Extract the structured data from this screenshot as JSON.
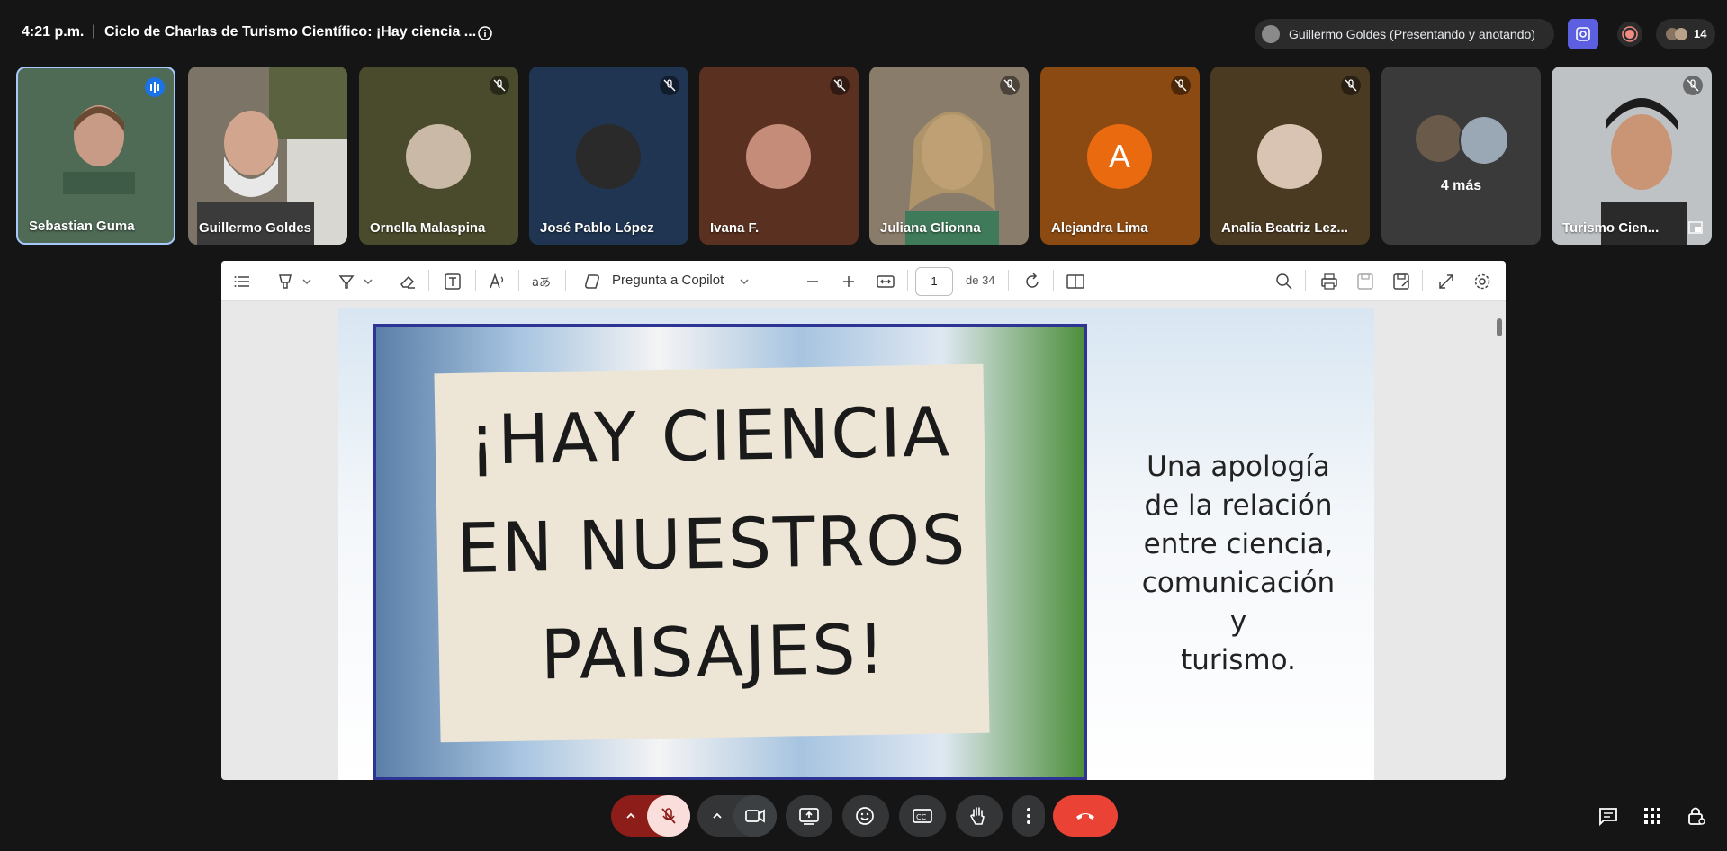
{
  "meeting": {
    "time": "4:21 p.m.",
    "separator": "|",
    "title": "Ciclo de Charlas de Turismo Científico: ¡Hay ciencia ...",
    "presenter_label": "Guillermo Goldes (Presentando y anotando)",
    "participant_count": "14"
  },
  "tiles": [
    {
      "name": "Sebastian Guma",
      "bg": "#4f6a55",
      "speaking": true
    },
    {
      "name": "Guillermo Goldes",
      "bg": "#7c7466"
    },
    {
      "name": "Ornella Malaspina",
      "bg": "#4a4a2c",
      "avatar": "#c9b9a6",
      "muted": true
    },
    {
      "name": "José Pablo López",
      "bg": "#1f3552",
      "avatar": "#2a2a2a",
      "muted": true
    },
    {
      "name": "Ivana F.",
      "bg": "#5a3020",
      "avatar": "#c58c7a",
      "muted": true
    },
    {
      "name": "Juliana Glionna",
      "bg": "#7a6c5c",
      "muted": true
    },
    {
      "name": "Alejandra Lima",
      "bg": "#8b4a12",
      "avatar_letter": "A",
      "avatar": "#ea6a10",
      "muted": true
    },
    {
      "name": "Analia Beatriz Lez...",
      "bg": "#4b3a22",
      "avatar": "#d9c3b2",
      "muted": true
    },
    {
      "name": "4 más",
      "bg": "#3a3a3a"
    },
    {
      "name": "Turismo Cien...",
      "bg": "#6c6a66",
      "muted": true
    }
  ],
  "pdf_toolbar": {
    "copilot": "Pregunta a Copilot",
    "page_current": "1",
    "page_total_label": "de 34"
  },
  "slide": {
    "banner_lines": [
      "¡HAY CIENCIA",
      "EN NUESTROS",
      "PAISAJES!"
    ],
    "side_text": [
      "Una apología",
      "de la relación",
      "entre ciencia,",
      "comunicación y",
      "turismo."
    ]
  },
  "colors": {
    "end_call": "#ea4335",
    "mic_off_bg": "#f9dedc",
    "mic_group": "#8c1d18",
    "slide_border": "#2e3493"
  }
}
